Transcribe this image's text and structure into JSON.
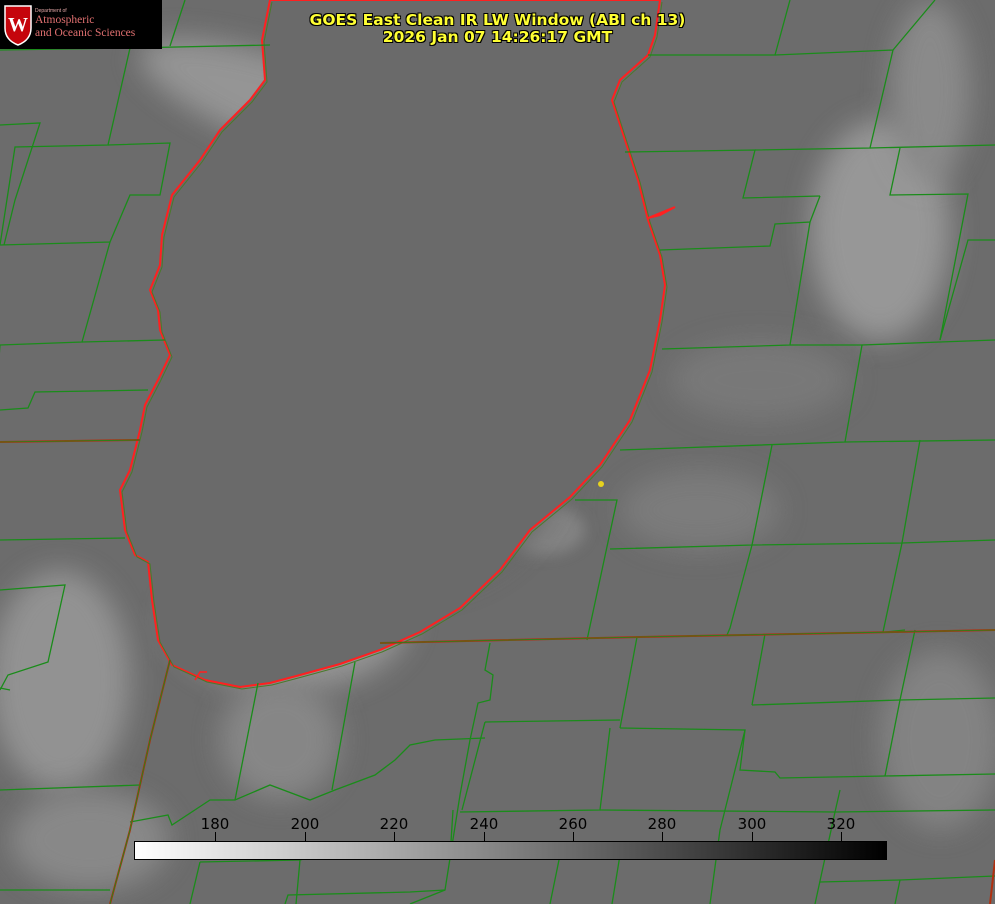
{
  "logo": {
    "small_text": "Department of",
    "line1": "Atmospheric",
    "line2": "and Oceanic Sciences"
  },
  "title": {
    "line1": "GOES East Clean IR LW Window (ABI ch 13)",
    "line2": "2026 Jan 07 14:26:17 GMT"
  },
  "colorbar": {
    "min": 162,
    "max": 330,
    "ticks": [
      "180",
      "200",
      "220",
      "240",
      "260",
      "280",
      "300",
      "320"
    ],
    "tick_values": [
      180,
      200,
      220,
      240,
      260,
      280,
      300,
      320
    ],
    "color_low": "#ffffff",
    "color_high": "#000000"
  },
  "colors": {
    "county_lines": "#1a8c1a",
    "state_lines": "#ff2020",
    "lake_shore": "#ff2020",
    "station_marker": "#e6d21e",
    "title_text": "#ffff33",
    "logo_text": "#e07070"
  }
}
